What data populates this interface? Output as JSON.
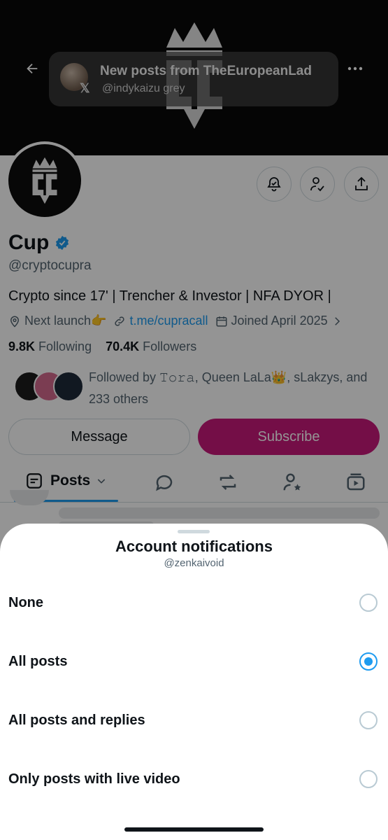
{
  "banner": {
    "logo": "crown-cc-logo"
  },
  "toast": {
    "title": "New posts from TheEuropeanLad",
    "x_mark": "𝕏",
    "subtitle": "@indykaizu grey"
  },
  "profile": {
    "name": "Cup",
    "handle": "@cryptocupra",
    "bio": "Crypto since 17' | Trencher & Investor | NFA DYOR |",
    "location": "Next launch👉",
    "link": "t.me/cupracall",
    "joined": "Joined April 2025",
    "following_count": "9.8K",
    "following_label": "Following",
    "followers_count": "70.4K",
    "followers_label": "Followers",
    "followed_by": "Followed by 𝚃𝚘𝚛𝚊, Queen LaLa👑, sLakzys, and 233 others",
    "message_label": "Message",
    "subscribe_label": "Subscribe"
  },
  "tabs": {
    "posts_label": "Posts"
  },
  "sheet": {
    "title": "Account notifications",
    "subtitle": "@zenkaivoid",
    "options": [
      {
        "label": "None",
        "selected": false
      },
      {
        "label": "All posts",
        "selected": true
      },
      {
        "label": "All posts and replies",
        "selected": false
      },
      {
        "label": "Only posts with live video",
        "selected": false
      }
    ]
  },
  "colors": {
    "accent": "#1d9bf0",
    "subscribe": "#c9197a",
    "text": "#0f1419",
    "muted": "#536471"
  }
}
